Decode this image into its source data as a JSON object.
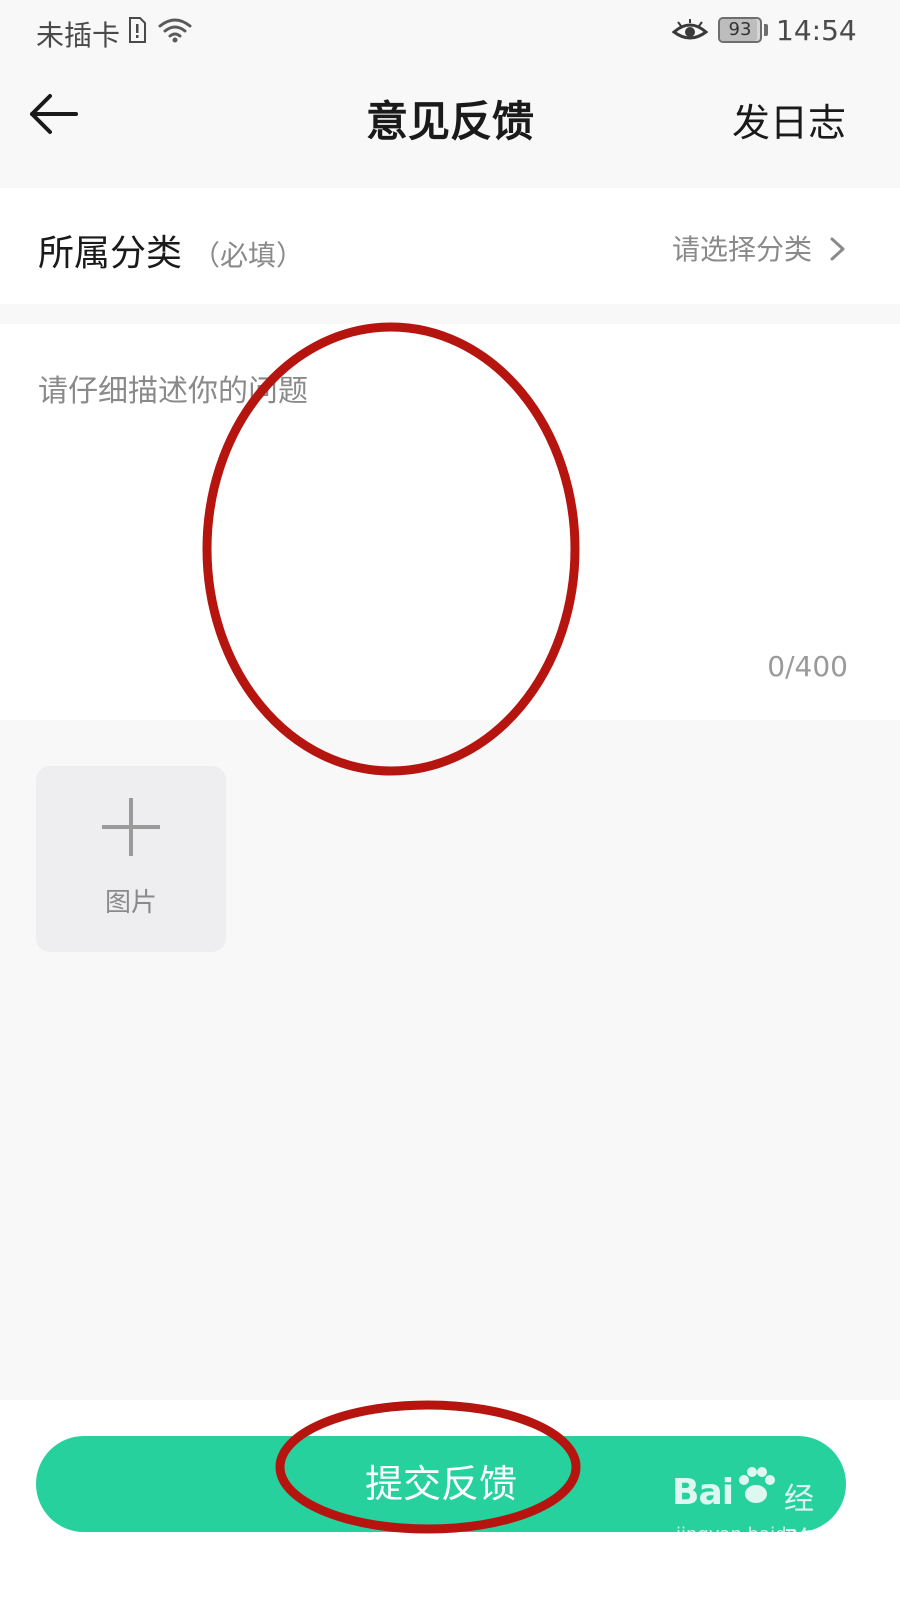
{
  "status_bar": {
    "carrier": "未插卡",
    "battery": "93",
    "battery_level": 0.93,
    "time": "14:54"
  },
  "nav": {
    "title": "意见反馈",
    "log_label": "发日志"
  },
  "category": {
    "label": "所属分类",
    "required_hint": "（必填）",
    "placeholder": "请选择分类"
  },
  "description": {
    "placeholder": "请仔细描述你的问题",
    "counter": "0/400"
  },
  "attachment": {
    "add_image_label": "图片"
  },
  "submit": {
    "label": "提交反馈"
  },
  "watermark": {
    "brand": "Bai",
    "suffix": "经验",
    "url": "jingyan.baidu.com"
  },
  "colors": {
    "accent": "#26d19e",
    "annotation": "#b5140f"
  },
  "icons": {
    "back": "arrow-left-icon",
    "chevron": "chevron-right-icon",
    "add": "plus-icon",
    "sim": "sim-card-icon",
    "wifi": "wifi-icon",
    "eye": "eye-icon"
  }
}
